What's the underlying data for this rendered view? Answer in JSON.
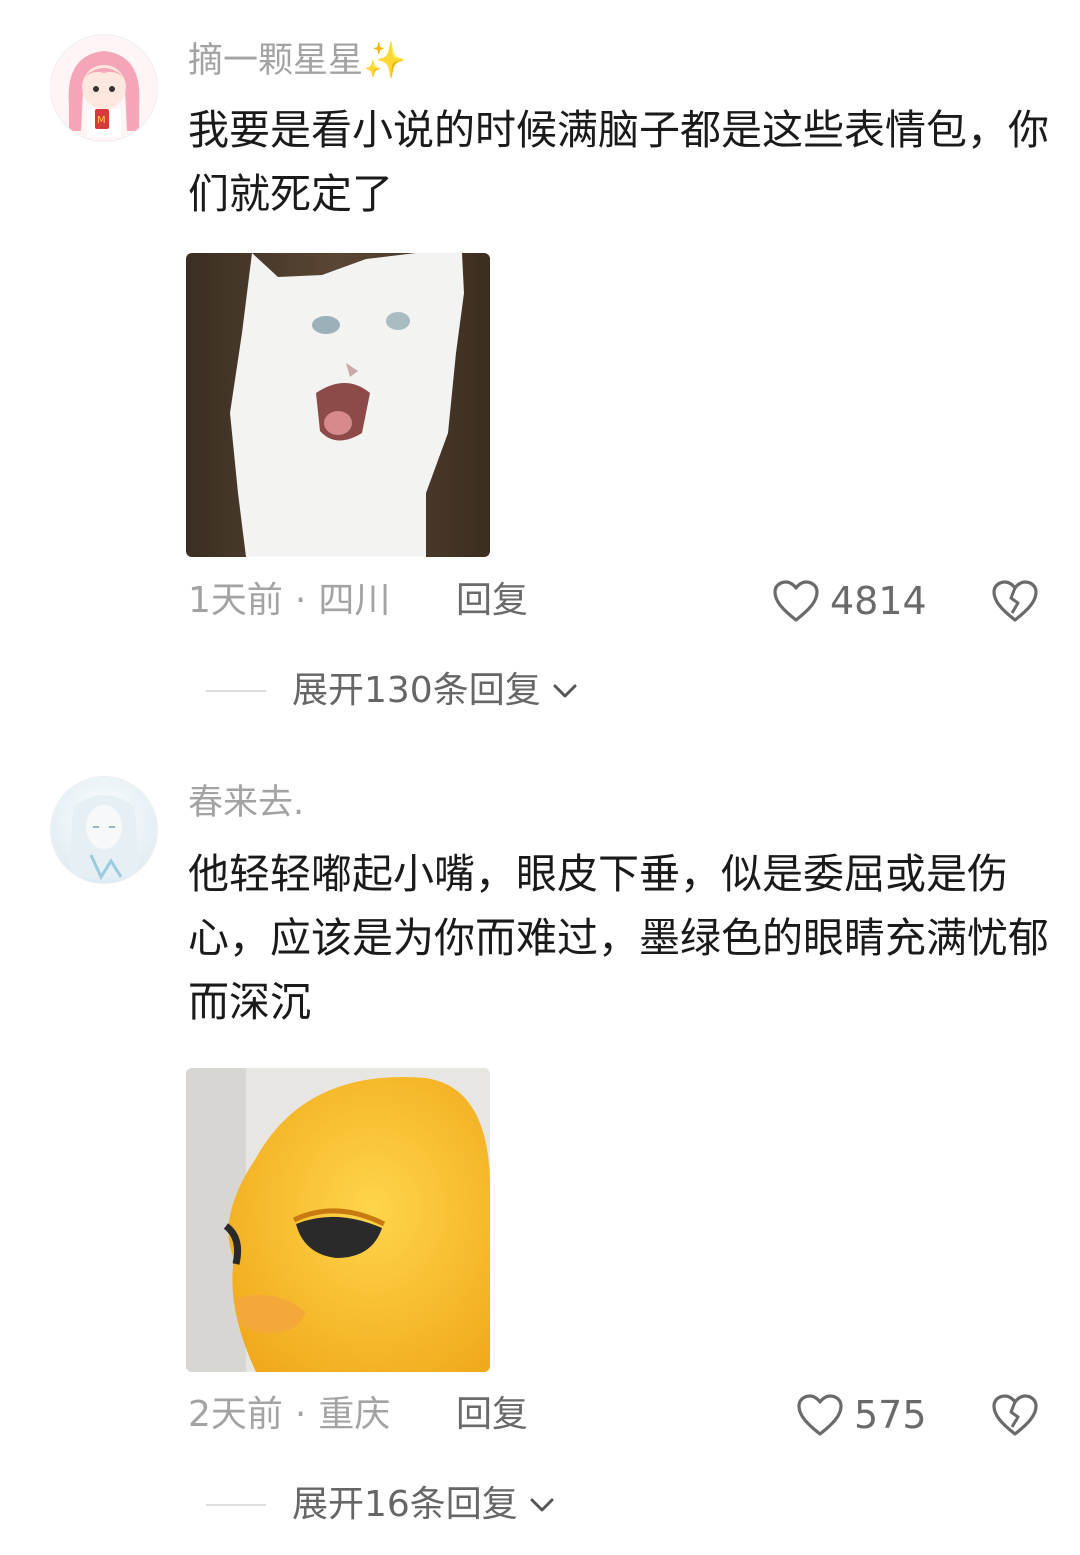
{
  "comments": [
    {
      "username": "摘一颗星星✨",
      "text": "我要是看小说的时候满脑子都是这些表情包，你们就死定了",
      "time": "1天前",
      "location": "四川",
      "reply_label": "回复",
      "likes": "4814",
      "expand_label": "展开130条回复",
      "avatar_icon": "pink-hair-girl-avatar",
      "image_icon": "screaming-white-cat-meme"
    },
    {
      "username": "春来去.",
      "text": "他轻轻嘟起小嘴，眼皮下垂，似是委屈或是伤心，应该是为你而难过，墨绿色的眼睛充满忧郁而深沉",
      "time": "2天前",
      "location": "重庆",
      "reply_label": "回复",
      "likes": "575",
      "expand_label": "展开16条回复",
      "avatar_icon": "pale-anime-character-avatar",
      "image_icon": "sad-yellow-duck-meme"
    }
  ],
  "colors": {
    "meta_gray": "#a3a3a3",
    "text": "#1a1a1a",
    "divider": "#dddddd"
  }
}
